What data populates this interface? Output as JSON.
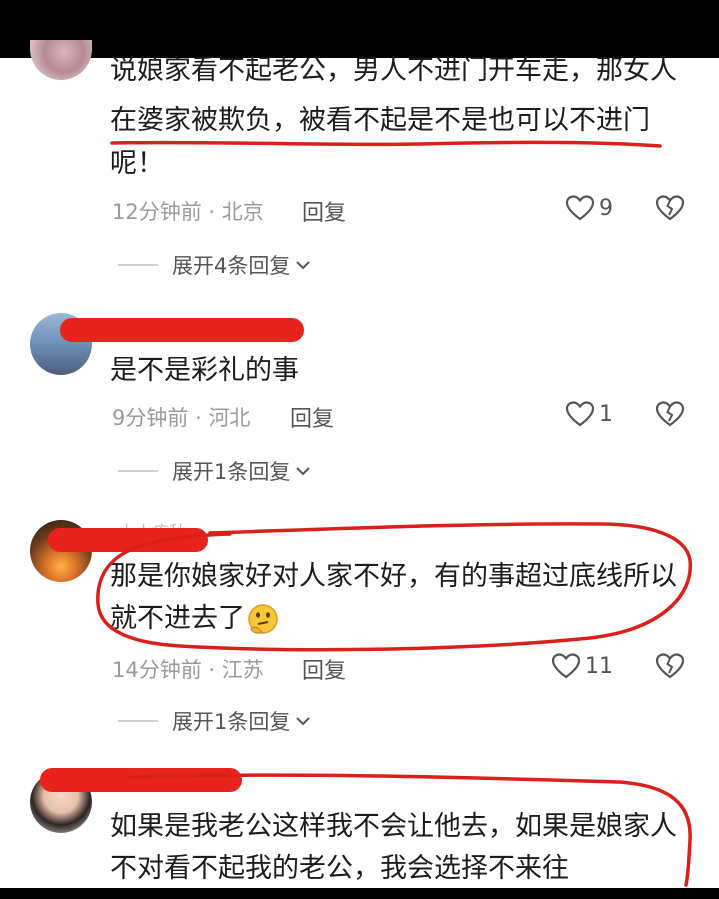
{
  "comments": [
    {
      "text_lines": [
        "说娘家看不起老公，男人不进门开车走，那女人",
        "在婆家被欺负，被看不起是不是也可以不进门",
        "呢！"
      ],
      "time": "12分钟前",
      "location": "北京",
      "reply_label": "回复",
      "likes": "9",
      "expand_label": "展开4条回复"
    },
    {
      "text_lines": [
        "是不是彩礼的事"
      ],
      "time": "9分钟前",
      "location": "河北",
      "reply_label": "回复",
      "likes": "1",
      "expand_label": "展开1条回复"
    },
    {
      "username_fragment": "小小疼秋",
      "text_lines": [
        "那是你娘家好对人家不好，有的事超过底线所以",
        "就不进去了"
      ],
      "time": "14分钟前",
      "location": "江苏",
      "reply_label": "回复",
      "likes": "11",
      "expand_label": "展开1条回复"
    },
    {
      "text_lines": [
        "如果是我老公这样我不会让他去，如果是娘家人",
        "不对看不起我的老公，我会选择不来往"
      ]
    }
  ],
  "meta_separator": "·",
  "icons": {
    "like": "heart-outline-icon",
    "dislike": "broken-heart-icon",
    "expand": "chevron-down-icon",
    "emoji": "thinking-face-emoji"
  },
  "colors": {
    "annotation_red": "#d9201b",
    "meta_gray": "#9a9a9a",
    "text": "#1c1c1c"
  }
}
